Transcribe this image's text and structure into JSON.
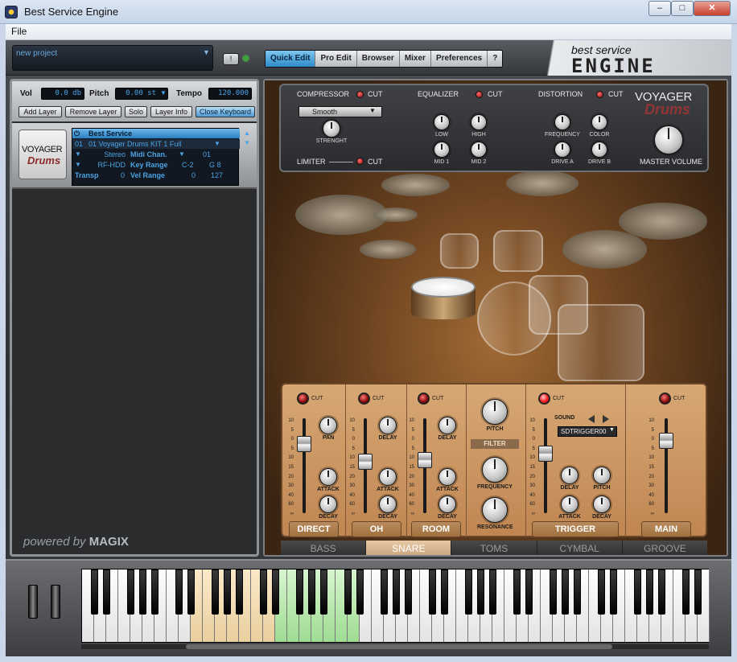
{
  "window": {
    "title": "Best Service Engine",
    "minimize": "–",
    "maximize": "□",
    "close": "✕"
  },
  "menu": {
    "file": "File"
  },
  "topbar": {
    "project_name": "new project",
    "tabs": [
      "Quick Edit",
      "Pro Edit",
      "Browser",
      "Mixer",
      "Preferences",
      "?"
    ],
    "active_tab": "Quick Edit",
    "brand_line1": "best service",
    "brand_line2": "ENGINE"
  },
  "left": {
    "vol_label": "Vol",
    "vol_value": "0.0 db",
    "pitch_label": "Pitch",
    "pitch_value": "0.00 st",
    "tempo_label": "Tempo",
    "tempo_value": "120.000",
    "buttons": [
      "Add Layer",
      "Remove Layer",
      "Solo",
      "Layer Info",
      "Close Keyboard"
    ],
    "logo_line1": "VOYAGER",
    "logo_line2": "Drums",
    "instrument": {
      "vendor": "Best Service",
      "slot": "01",
      "patch": "01 Voyager Drums KIT 1 Full",
      "output": "Stereo",
      "midi_label": "Midi Chan.",
      "midi_value": "01",
      "mode": "RF-HDD",
      "keyrange_label": "Key Range",
      "key_lo": "C-2",
      "key_hi": "G 8",
      "transp_label": "Transp",
      "transp_value": "0",
      "velrange_label": "Vel Range",
      "vel_lo": "0",
      "vel_hi": "127"
    },
    "powered_by": "powered by",
    "powered_brand": "MAGIX"
  },
  "fx": {
    "compressor": "COMPRESSOR",
    "equalizer": "EQUALIZER",
    "distortion": "DISTORTION",
    "cut": "CUT",
    "mode": "Smooth",
    "strength": "STRENGHT",
    "limiter": "LIMITER",
    "eq_knobs": [
      "LOW",
      "HIGH",
      "MID 1",
      "MID 2"
    ],
    "dist_knobs": [
      "FREQUENCY",
      "COLOR",
      "DRIVE A",
      "DRIVE B"
    ],
    "master": "MASTER VOLUME",
    "logo_line1": "VOYAGER",
    "logo_line2": "Drums"
  },
  "mixer": {
    "cut": "CUT",
    "scale": [
      "10",
      "5",
      "0",
      "5",
      "10",
      "15",
      "20",
      "30",
      "40",
      "60",
      "∞"
    ],
    "direct": {
      "name": "DIRECT",
      "knobs": [
        "PAN",
        "ATTACK",
        "DECAY"
      ]
    },
    "oh": {
      "name": "OH",
      "knobs": [
        "DELAY",
        "ATTACK",
        "DECAY"
      ]
    },
    "room": {
      "name": "ROOM",
      "knobs": [
        "DELAY",
        "ATTACK",
        "DECAY"
      ]
    },
    "pitch": "PITCH",
    "filter": {
      "title": "FILTER",
      "knobs": [
        "FREQUENCY",
        "RESONANCE"
      ]
    },
    "trigger": {
      "name": "TRIGGER",
      "sound_label": "SOUND",
      "sound_value": "SDTRIGGER00",
      "knobs": [
        "DELAY",
        "PITCH",
        "ATTACK",
        "DECAY"
      ]
    },
    "main": {
      "name": "MAIN"
    }
  },
  "bottom_tabs": [
    "BASS",
    "SNARE",
    "TOMS",
    "CYMBAL",
    "GROOVE"
  ],
  "active_bottom_tab": "SNARE"
}
